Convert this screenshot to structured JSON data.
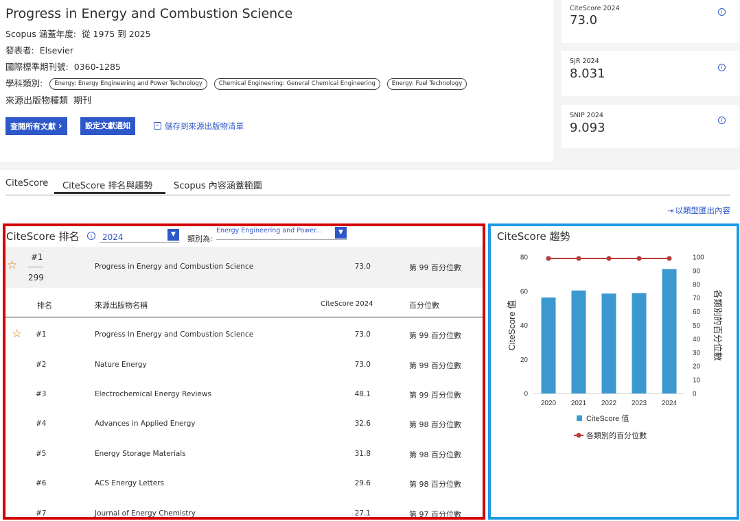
{
  "journal": {
    "title": "Progress in Energy and Combustion Science",
    "coverage_label": "Scopus 涵蓋年度:",
    "coverage_value": "從 1975 到 2025",
    "publisher_label": "發表者:",
    "publisher_value": "Elsevier",
    "issn_label": "國際標準期刊號:",
    "issn_value": "0360-1285",
    "subject_label": "學科類別:",
    "subjects": [
      "Energy: Energy Engineering and Power Technology",
      "Chemical Engineering: General Chemical Engineering",
      "Energy: Fuel Technology"
    ],
    "source_type_label": "來源出版物種類",
    "source_type_value": "期刊"
  },
  "actions": {
    "view_docs": "查閱所有文獻",
    "view_docs_chevron": "›",
    "set_alert": "設定文獻通知",
    "save_list": "儲存到來源出版物清單"
  },
  "metrics": [
    {
      "label": "CiteScore 2024",
      "value": "73.0"
    },
    {
      "label": "SJR 2024",
      "value": "8.031"
    },
    {
      "label": "SNIP 2024",
      "value": "9.093"
    }
  ],
  "info_glyph": "i",
  "tabs": [
    "CiteScore",
    "CiteScore 排名與趨勢",
    "Scopus 內容涵蓋範圍"
  ],
  "export_label": "以類型匯出內容",
  "ranking": {
    "title": "CiteScore 排名",
    "year": "2024",
    "category_label": "類別為:",
    "category_value": "Energy Engineering and Power...",
    "highlight": {
      "rank": "#1",
      "total": "299",
      "name": "Progress in Energy and Combustion Science",
      "citescore": "73.0",
      "percentile": "第 99 百分位數"
    },
    "headers": {
      "rank": "排名",
      "name": "來源出版物名稱",
      "citescore": "CiteScore 2024",
      "percentile": "百分位數"
    },
    "rows": [
      {
        "rank": "#1",
        "name": "Progress in Energy and Combustion Science",
        "citescore": "73.0",
        "percentile": "第 99 百分位數",
        "starred": true
      },
      {
        "rank": "#2",
        "name": "Nature Energy",
        "citescore": "73.0",
        "percentile": "第 99 百分位數",
        "starred": false
      },
      {
        "rank": "#3",
        "name": "Electrochemical Energy Reviews",
        "citescore": "48.1",
        "percentile": "第 99 百分位數",
        "starred": false
      },
      {
        "rank": "#4",
        "name": "Advances in Applied Energy",
        "citescore": "32.6",
        "percentile": "第 98 百分位數",
        "starred": false
      },
      {
        "rank": "#5",
        "name": "Energy Storage Materials",
        "citescore": "31.8",
        "percentile": "第 98 百分位數",
        "starred": false
      },
      {
        "rank": "#6",
        "name": "ACS Energy Letters",
        "citescore": "29.6",
        "percentile": "第 98 百分位數",
        "starred": false
      },
      {
        "rank": "#7",
        "name": "Journal of Energy Chemistry",
        "citescore": "27.1",
        "percentile": "第 97 百分位數",
        "starred": false
      }
    ]
  },
  "trend": {
    "title": "CiteScore 趨勢"
  },
  "chart_data": {
    "type": "bar",
    "categories": [
      "2020",
      "2021",
      "2022",
      "2023",
      "2024"
    ],
    "series": [
      {
        "name": "CiteScore 值",
        "kind": "bar",
        "axis": "left",
        "values": [
          56.3,
          60.4,
          58.6,
          58.9,
          73.0
        ],
        "color": "#3b99cf"
      },
      {
        "name": "各類別的百分位數",
        "kind": "line",
        "axis": "right",
        "values": [
          99,
          99,
          99,
          99,
          99
        ],
        "color": "#b63c3c"
      }
    ],
    "ylabel": "CiteScore 值",
    "y2label": "各類別的百分位數",
    "ylim": [
      0,
      80
    ],
    "y2lim": [
      0,
      100
    ],
    "yticks": [
      "0",
      "20",
      "40",
      "60",
      "80"
    ],
    "y2ticks": [
      "0",
      "10",
      "20",
      "30",
      "40",
      "50",
      "60",
      "70",
      "80",
      "90",
      "100"
    ],
    "grid": false,
    "legend": "bottom"
  },
  "colors": {
    "accent": "#2e57c9",
    "star": "#d37200",
    "highlight_red": "#d30000",
    "highlight_blue": "#1c9ae4"
  },
  "icons": {
    "star": "star-outline-icon",
    "info": "info-icon",
    "save": "floppy-disk-icon",
    "export": "export-icon",
    "dropdown": "chevron-down-icon"
  }
}
